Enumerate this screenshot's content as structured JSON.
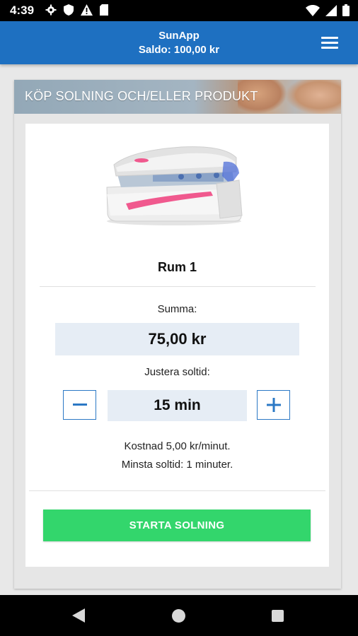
{
  "status_bar": {
    "time": "4:39",
    "left_icons": [
      "gear-icon",
      "shield-icon",
      "warning-icon",
      "sd-card-icon"
    ],
    "right_icons": [
      "wifi-icon",
      "signal-icon",
      "battery-icon"
    ]
  },
  "app_bar": {
    "title": "SunApp",
    "balance": "Saldo: 100,00 kr",
    "menu_icon": "hamburger-menu-icon",
    "color": "#1e70c1"
  },
  "banner": {
    "title": "KÖP SOLNING OCH/ELLER PRODUKT"
  },
  "room": {
    "name": "Rum 1",
    "image": "tanning-bed"
  },
  "sum": {
    "label": "Summa:",
    "value": "75,00 kr"
  },
  "adjust": {
    "label": "Justera soltid:",
    "time_value": "15 min",
    "minus_icon": "minus-icon",
    "plus_icon": "plus-icon",
    "accent": "#2b78c5"
  },
  "info": {
    "cost": "Kostnad 5,00 kr/minut.",
    "min_time": "Minsta soltid: 1 minuter."
  },
  "start_button": {
    "label": "STARTA SOLNING",
    "color": "#33d66c"
  },
  "nav_bar": {
    "icons": [
      "back-icon",
      "home-icon",
      "recents-icon"
    ]
  }
}
